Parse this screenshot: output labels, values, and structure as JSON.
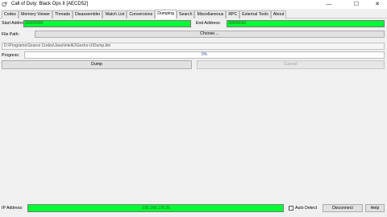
{
  "window": {
    "title": "Call of Duty: Black Ops II [AECD52]",
    "app_icon": "🜚",
    "minimize_glyph": "—",
    "maximize_glyph": "☐",
    "close_glyph": "✕"
  },
  "tabs": [
    {
      "label": "Codes"
    },
    {
      "label": "Memory Viewer"
    },
    {
      "label": "Threads"
    },
    {
      "label": "Disassembler"
    },
    {
      "label": "Watch List"
    },
    {
      "label": "Conversions"
    },
    {
      "label": "Dumping",
      "active": true
    },
    {
      "label": "Search"
    },
    {
      "label": "Miscellaneous"
    },
    {
      "label": "RPC"
    },
    {
      "label": "External Tools"
    },
    {
      "label": "About"
    }
  ],
  "dump": {
    "start_label": "Start Address:",
    "start_value": "02000000",
    "end_label": "End Address:",
    "end_value": "30000000",
    "file_path_label": "File Path:",
    "choose_label": "Choose....",
    "file_path_value": "D:\\Programs\\Source Codes\\Java\\IntelliJ\\Gecko U\\Dump.bin",
    "progress_label": "Progress:",
    "progress_text": "0%",
    "progress_value": 0,
    "dump_button": "Dump",
    "cancel_button": "Cancel"
  },
  "connection": {
    "ip_label": "IP Address:",
    "ip_value": "192.168.178.35",
    "auto_detect_label": "Auto Detect",
    "disconnect_button": "Disconnect",
    "help_button": "Help"
  },
  "colors": {
    "field_green": "#00ff33"
  }
}
